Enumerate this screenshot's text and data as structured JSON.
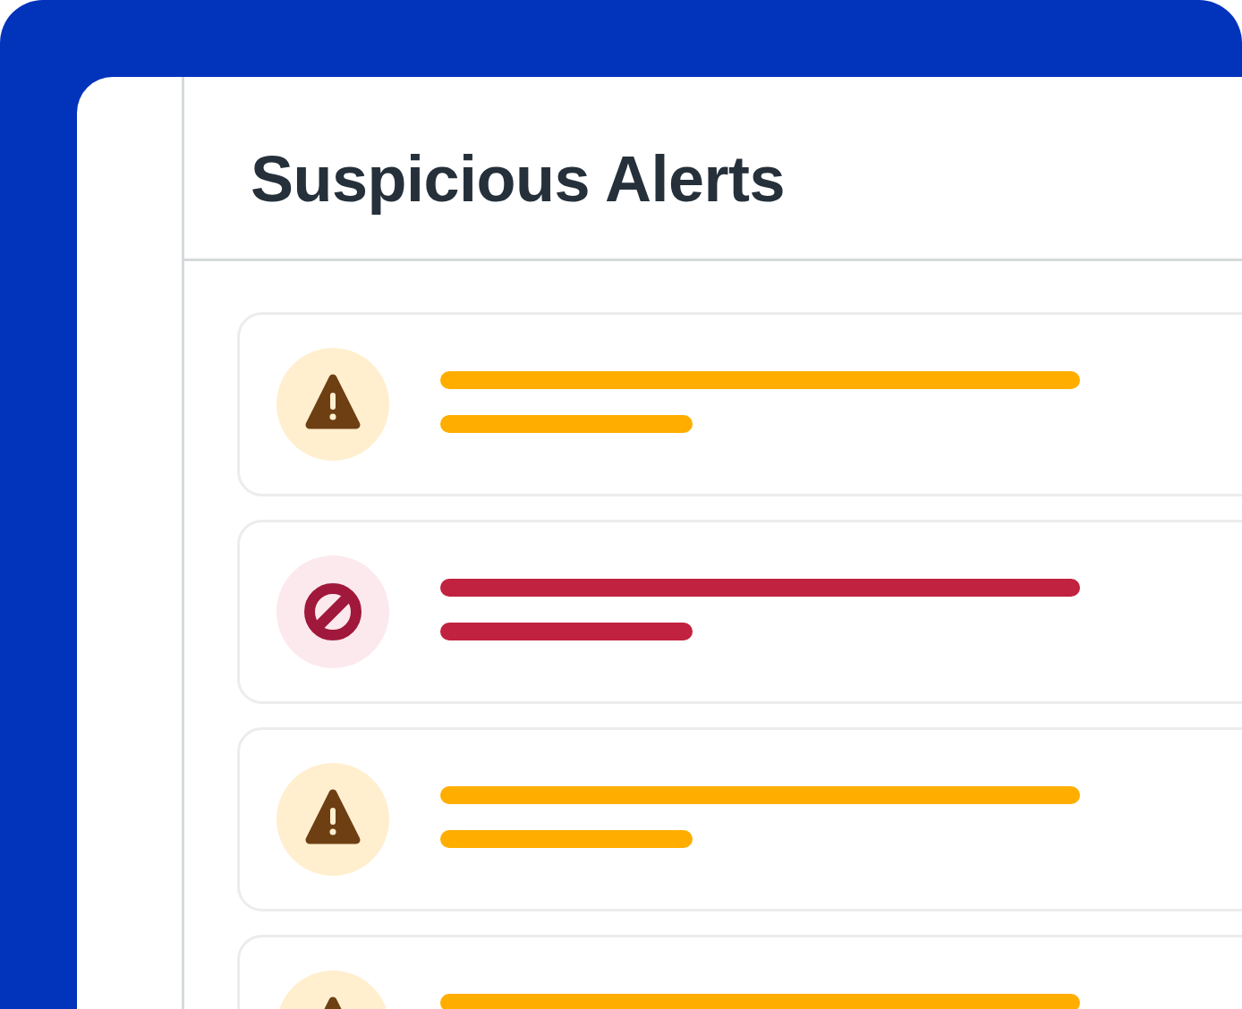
{
  "title": "Suspicious Alerts",
  "alerts": [
    {
      "kind": "warning"
    },
    {
      "kind": "blocked"
    },
    {
      "kind": "warning"
    },
    {
      "kind": "warning"
    }
  ]
}
